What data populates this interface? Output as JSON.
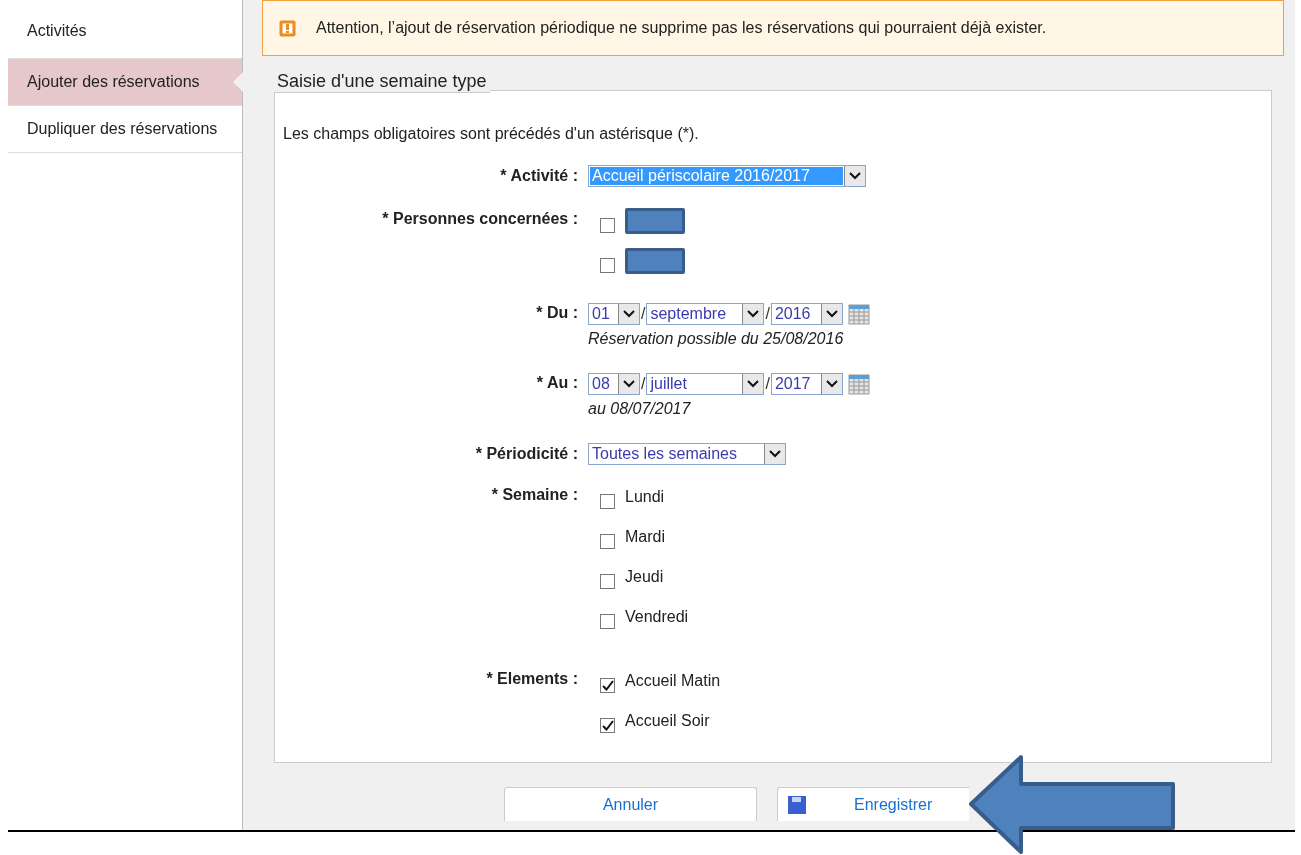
{
  "sidebar": {
    "items": [
      {
        "label": "Activités",
        "selected": false
      },
      {
        "label": "Ajouter des réservations",
        "selected": true
      },
      {
        "label": "Dupliquer des réservations",
        "selected": false
      }
    ]
  },
  "notice": {
    "text": "Attention, l’ajout de réservation périodique ne supprime pas les réservations qui pourraient déjà exister."
  },
  "form": {
    "legend": "Saisie d'une semaine type",
    "intro": "Les champs obligatoires sont précédés d'un astérisque (*).",
    "fields": [
      {
        "kind": "select",
        "label": "* Activité :",
        "value": "Accueil périscolaire 2016/2017",
        "highlighted": true
      },
      {
        "kind": "checklist",
        "label": "* Personnes concernées :",
        "options": [
          {
            "checked": false
          },
          {
            "checked": false
          }
        ]
      },
      {
        "kind": "date",
        "label": "* Du :",
        "day": "01",
        "month": "septembre",
        "year": "2016",
        "separator": "/",
        "note": "Réservation possible du 25/08/2016"
      },
      {
        "kind": "date",
        "label": "* Au :",
        "day": "08",
        "month": "juillet",
        "year": "2017",
        "separator": "/",
        "note": "au 08/07/2017"
      },
      {
        "kind": "select",
        "label": "* Périodicité :",
        "value": "Toutes les semaines",
        "highlighted": false
      },
      {
        "kind": "checklist",
        "label": "* Semaine :",
        "options": [
          {
            "label": "Lundi",
            "checked": false
          },
          {
            "label": "Mardi",
            "checked": false
          },
          {
            "label": "Jeudi",
            "checked": false
          },
          {
            "label": "Vendredi",
            "checked": false
          }
        ]
      },
      {
        "kind": "checklist",
        "label": "* Elements :",
        "options": [
          {
            "label": "Accueil Matin",
            "checked": true
          },
          {
            "label": "Accueil Soir",
            "checked": true
          }
        ]
      }
    ]
  },
  "buttons": [
    {
      "label": "Annuler",
      "kind": "cancel"
    },
    {
      "label": "Enregistrer",
      "kind": "save"
    }
  ]
}
